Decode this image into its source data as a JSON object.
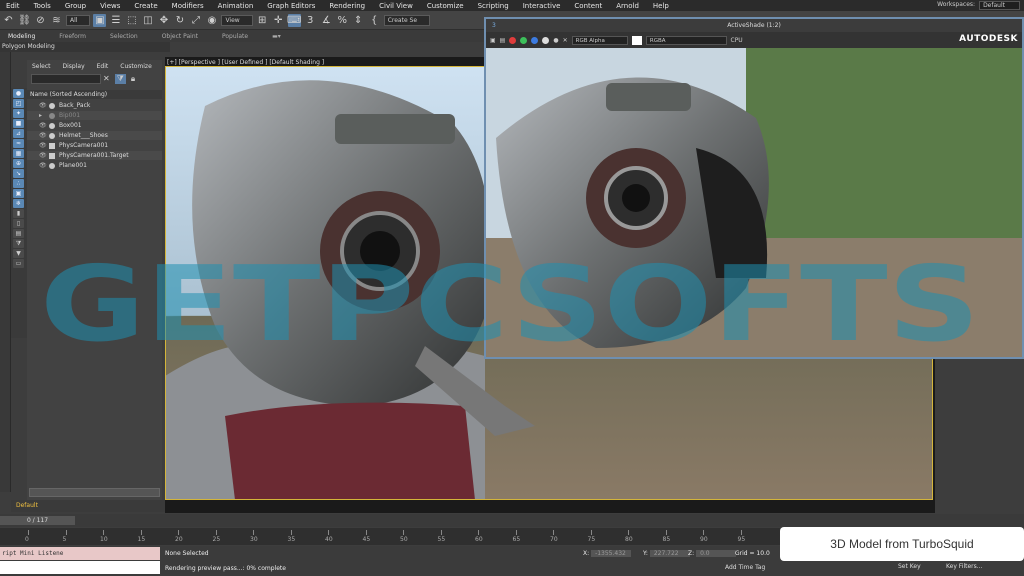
{
  "menubar": {
    "items": [
      "Edit",
      "Tools",
      "Group",
      "Views",
      "Create",
      "Modifiers",
      "Animation",
      "Graph Editors",
      "Rendering",
      "Civil View",
      "Customize",
      "Scripting",
      "Interactive",
      "Content",
      "Arnold",
      "Help"
    ],
    "workspace_label": "Workspaces:",
    "workspace_value": "Default"
  },
  "toolbar": {
    "filter_value": "All",
    "view_value": "View",
    "selection_set": "Create Se"
  },
  "ribbon": {
    "tabs": [
      "Modeling",
      "Freeform",
      "Selection",
      "Object Paint",
      "Populate"
    ],
    "sub_label": "Polygon Modeling"
  },
  "scene_explorer": {
    "menu": [
      "Select",
      "Display",
      "Edit",
      "Customize"
    ],
    "header": "Name (Sorted Ascending)",
    "rows": [
      "Back_Pack",
      "Bip001",
      "Box001",
      "Helmet___Shoes",
      "PhysCamera001",
      "PhysCamera001.Target",
      "Plane001"
    ]
  },
  "layer": {
    "value": "Default"
  },
  "viewport": {
    "label": "[+] [Perspective ] [User Defined ] [Default Shading ]"
  },
  "activeshade": {
    "title": "ActiveShade (1:2)",
    "channel": "RGB Alpha",
    "mode": "RGBA",
    "device": "CPU",
    "brand": "AUTODESK"
  },
  "timeline": {
    "frame_counter": "0 / 117",
    "ticks": [
      "0",
      "5",
      "10",
      "15",
      "20",
      "25",
      "30",
      "35",
      "40",
      "45",
      "50",
      "55",
      "60",
      "65",
      "70",
      "75",
      "80",
      "85",
      "90",
      "95"
    ]
  },
  "status": {
    "maxscript": "ript Mini Listene",
    "selected": "None Selected",
    "progress": "Rendering preview pass...: 0% complete",
    "x_label": "X:",
    "x_value": "-1355.432",
    "y_label": "Y:",
    "y_value": "227.722",
    "z_label": "Z:",
    "z_value": "0.0",
    "grid": "Grid = 10.0",
    "add_time_tag": "Add Time Tag",
    "set_key": "Set Key",
    "key_filters": "Key Filters..."
  },
  "overlay": {
    "turbosquid": "3D Model from TurboSquid",
    "watermark": "GETPCSOFTS"
  },
  "colors": {
    "accent": "#5b7fa6",
    "frame": "#d4b53a",
    "watermark": "#1f8fb0"
  }
}
